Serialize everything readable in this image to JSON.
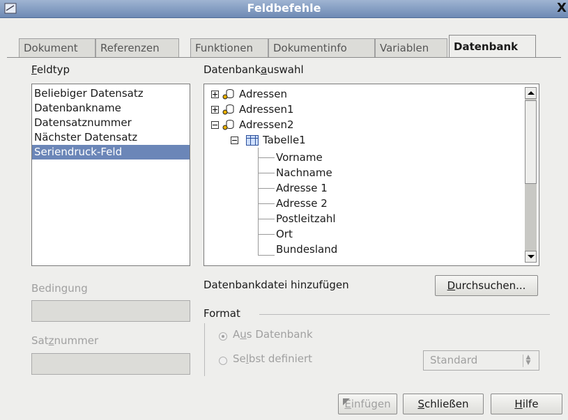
{
  "window": {
    "title": "Feldbefehle",
    "close_glyph": "X"
  },
  "tabs": [
    {
      "label": "Dokument"
    },
    {
      "label": "Referenzen"
    },
    {
      "label": "Funktionen"
    },
    {
      "label": "Dokumentinfo"
    },
    {
      "label": "Variablen"
    },
    {
      "label": "Datenbank",
      "active": true
    }
  ],
  "fieldtype": {
    "label_pre": "",
    "label_accel": "F",
    "label_post": "eldtyp",
    "items": [
      "Beliebiger Datensatz",
      "Datenbankname",
      "Datensatznummer",
      "Nächster Datensatz",
      "Seriendruck-Feld"
    ],
    "selected": "Seriendruck-Feld"
  },
  "dbselect": {
    "label_pre": "Datenbank",
    "label_accel": "a",
    "label_post": "uswahl",
    "tree": {
      "databases": [
        "Adressen",
        "Adressen1",
        "Adressen2"
      ],
      "table": "Tabelle1",
      "fields": [
        "Vorname",
        "Nachname",
        "Adresse 1",
        "Adresse 2",
        "Postleitzahl",
        "Ort",
        "Bundesland"
      ]
    }
  },
  "condition": {
    "label_pre": "Bedin",
    "label_accel": "g",
    "label_post": "ung",
    "value": ""
  },
  "record": {
    "label_pre": "Sat",
    "label_accel": "z",
    "label_post": "nummer",
    "value": ""
  },
  "dbfile": {
    "label": "Datenbankdatei hinzufügen",
    "browse_pre": "",
    "browse_accel": "D",
    "browse_post": "urchsuchen..."
  },
  "format": {
    "label": "Format",
    "from_db_pre": "A",
    "from_db_accel": "u",
    "from_db_post": "s Datenbank",
    "user_pre": "Se",
    "user_accel": "l",
    "user_post": "bst definiert",
    "spin_value": "Standard",
    "selected_option": "from_db"
  },
  "buttons": {
    "insert_pre": "",
    "insert_accel": "E",
    "insert_post": "infügen",
    "close_pre": "",
    "close_accel": "S",
    "close_post": "chließen",
    "help_pre": "",
    "help_accel": "H",
    "help_post": "ilfe"
  },
  "colors": {
    "selection": "#6b86b8",
    "titlebar": "#7f98be",
    "dialog_bg": "#eeeeec"
  }
}
